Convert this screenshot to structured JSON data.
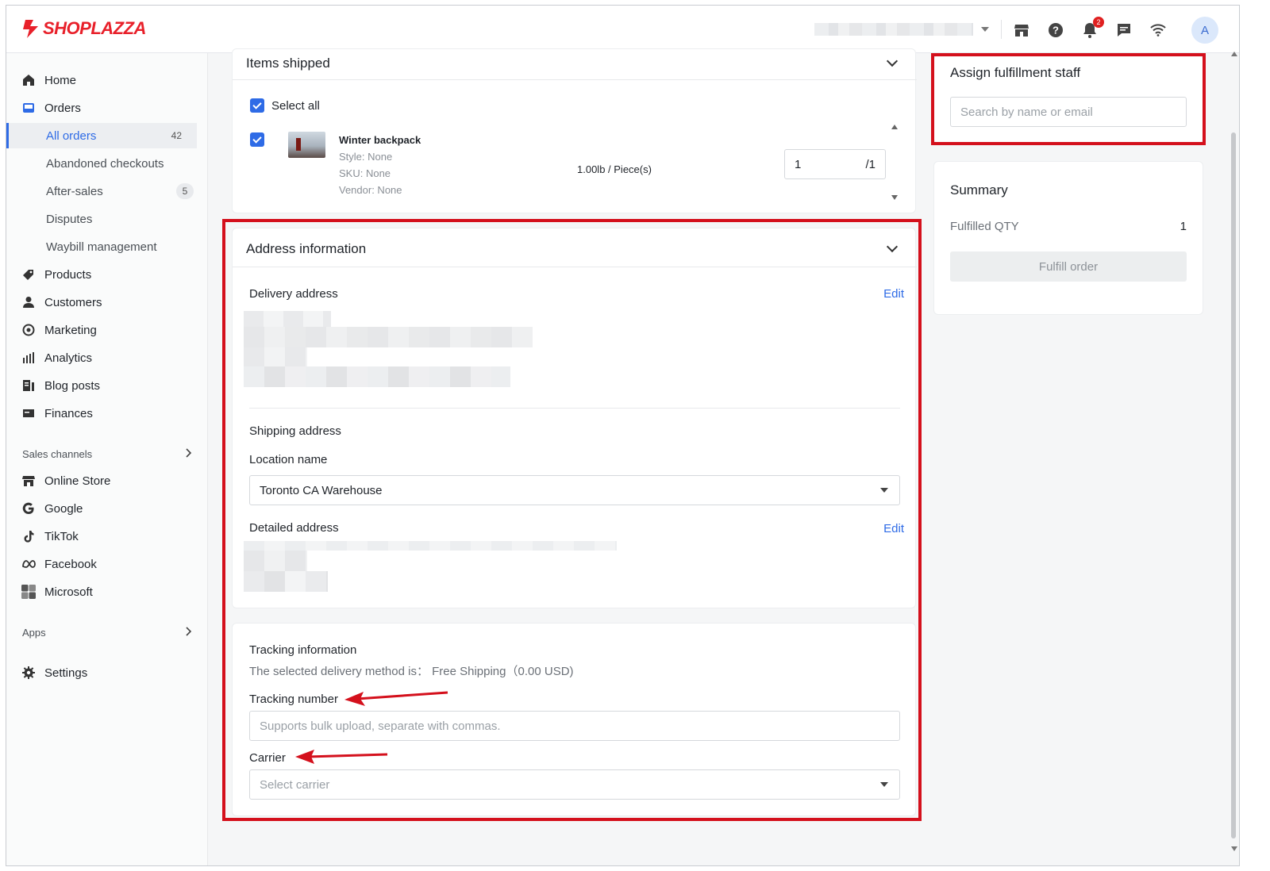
{
  "brand": {
    "name": "SHOPLAZZA",
    "color": "#e8202a"
  },
  "topbar": {
    "icons": [
      "store-icon",
      "help-icon",
      "bell-icon",
      "chat-icon",
      "wifi-icon"
    ],
    "notification_count": "2",
    "avatar_letter": "A"
  },
  "sidebar": {
    "home": "Home",
    "orders": "Orders",
    "orders_sub": {
      "all_orders": "All orders",
      "all_orders_count": "42",
      "abandoned": "Abandoned checkouts",
      "after_sales": "After-sales",
      "after_sales_count": "5",
      "disputes": "Disputes",
      "waybill": "Waybill management"
    },
    "products": "Products",
    "customers": "Customers",
    "marketing": "Marketing",
    "analytics": "Analytics",
    "blog_posts": "Blog posts",
    "finances": "Finances",
    "sales_channels": "Sales channels",
    "online_store": "Online Store",
    "google": "Google",
    "tiktok": "TikTok",
    "facebook": "Facebook",
    "microsoft": "Microsoft",
    "apps": "Apps",
    "settings": "Settings"
  },
  "items_shipped": {
    "title": "Items shipped",
    "select_all": "Select all",
    "item": {
      "name": "Winter backpack",
      "style": "Style: None",
      "sku": "SKU: None",
      "vendor": "Vendor: None",
      "weight": "1.00lb / Piece(s)",
      "qty_value": "1",
      "qty_total": "/1"
    }
  },
  "address": {
    "title": "Address information",
    "delivery_label": "Delivery address",
    "edit": "Edit",
    "shipping_label": "Shipping address",
    "location_label": "Location name",
    "location_value": "Toronto CA Warehouse",
    "detailed_label": "Detailed address"
  },
  "tracking": {
    "title": "Tracking information",
    "delivery_method": "The selected delivery method is： Free Shipping（0.00 USD)",
    "number_label": "Tracking number",
    "number_placeholder": "Supports bulk upload, separate with commas.",
    "carrier_label": "Carrier",
    "carrier_placeholder": "Select carrier"
  },
  "staff": {
    "title": "Assign fulfillment staff",
    "search_placeholder": "Search by name or email"
  },
  "summary": {
    "title": "Summary",
    "fulfilled_label": "Fulfilled QTY",
    "fulfilled_value": "1",
    "button": "Fulfill order"
  },
  "colors": {
    "accent": "#2e6be6",
    "annotation_red": "#d4101c"
  }
}
